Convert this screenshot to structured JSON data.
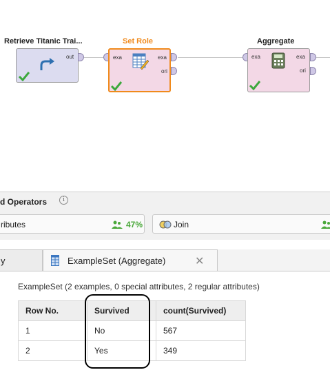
{
  "process": {
    "operators": [
      {
        "title": "Retrieve Titanic Trai...",
        "ports_out": [
          "out"
        ],
        "status": "ok"
      },
      {
        "title": "Set Role",
        "ports_in": [
          "exa"
        ],
        "ports_out": [
          "exa",
          "ori"
        ],
        "status": "ok",
        "selected": true,
        "title_color": "#f08a1c"
      },
      {
        "title": "Aggregate",
        "ports_in": [
          "exa"
        ],
        "ports_out": [
          "exa",
          "ori"
        ],
        "status": "ok"
      }
    ]
  },
  "operators_panel": {
    "heading": "d Operators",
    "chips": [
      {
        "label": "ributes",
        "percent": "47%"
      },
      {
        "label": "Join"
      }
    ]
  },
  "results": {
    "tabs": [
      {
        "label": "y",
        "active": false
      },
      {
        "label": "ExampleSet (Aggregate)",
        "active": true
      }
    ],
    "summary": "ExampleSet (2 examples, 0 special attributes, 2 regular attributes)",
    "table": {
      "columns": [
        "Row No.",
        "Survived",
        "count(Survived)"
      ],
      "rows": [
        [
          "1",
          "No",
          "567"
        ],
        [
          "2",
          "Yes",
          "349"
        ]
      ]
    }
  },
  "colors": {
    "accent": "#f08a1c",
    "retrieve_box": "#dcdcf0",
    "transform_box": "#f3d8e6",
    "ok_green": "#3ca83c"
  },
  "icons": [
    "retrieve-arrow-icon",
    "table-edit-icon",
    "calculator-icon",
    "checkmark-icon",
    "info-icon",
    "people-icon",
    "join-icon",
    "table-icon",
    "close-icon"
  ]
}
